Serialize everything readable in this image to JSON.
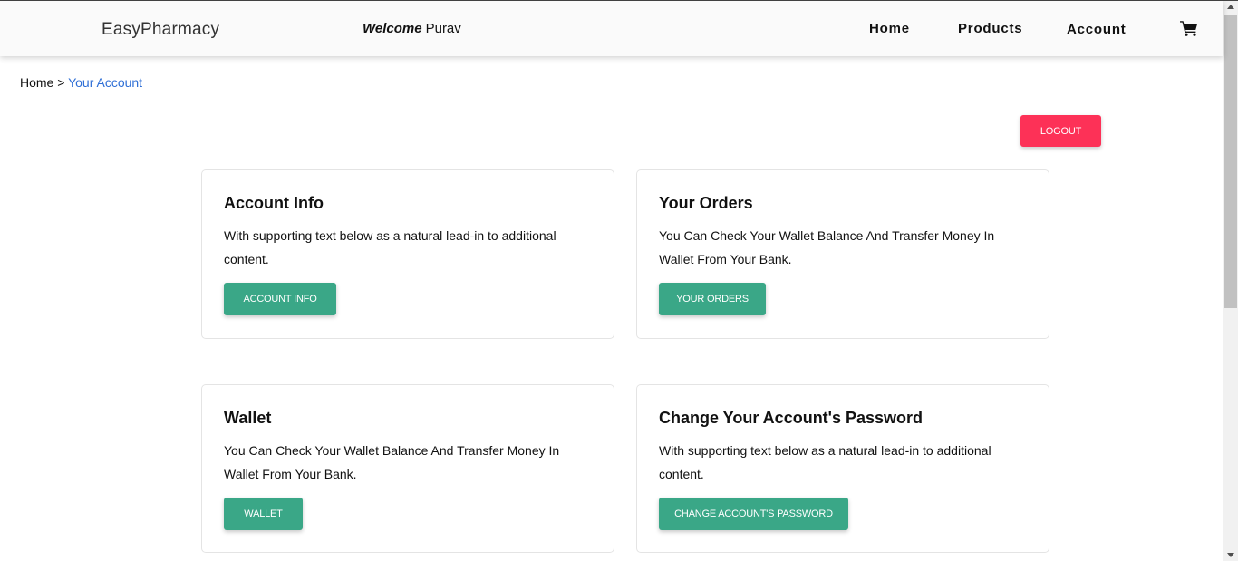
{
  "navbar": {
    "brand": "EasyPharmacy",
    "welcome_label": "Welcome",
    "user_name": "Purav",
    "links": [
      "Home",
      "Products",
      "Account"
    ],
    "cart_icon": "cart-icon"
  },
  "breadcrumb": {
    "home": "Home",
    "separator": ">",
    "current": "Your Account"
  },
  "logout_label": "LOGOUT",
  "cards": [
    {
      "title": "Account Info",
      "text": "With supporting text below as a natural lead-in to additional content.",
      "button": "ACCOUNT INFO"
    },
    {
      "title": "Your Orders",
      "text": "You Can Check Your Wallet Balance And Transfer Money In Wallet From Your Bank.",
      "button": "YOUR ORDERS"
    },
    {
      "title": "Wallet",
      "text": "You Can Check Your Wallet Balance And Transfer Money In Wallet From Your Bank.",
      "button": "WALLET"
    },
    {
      "title": "Change Your Account's Password",
      "text": "With supporting text below as a natural lead-in to additional content.",
      "button": "CHANGE ACCOUNT'S PASSWORD"
    }
  ],
  "colors": {
    "logout": "#fd3157",
    "card_button": "#3aa787",
    "breadcrumb_link": "#2f6fd6"
  }
}
